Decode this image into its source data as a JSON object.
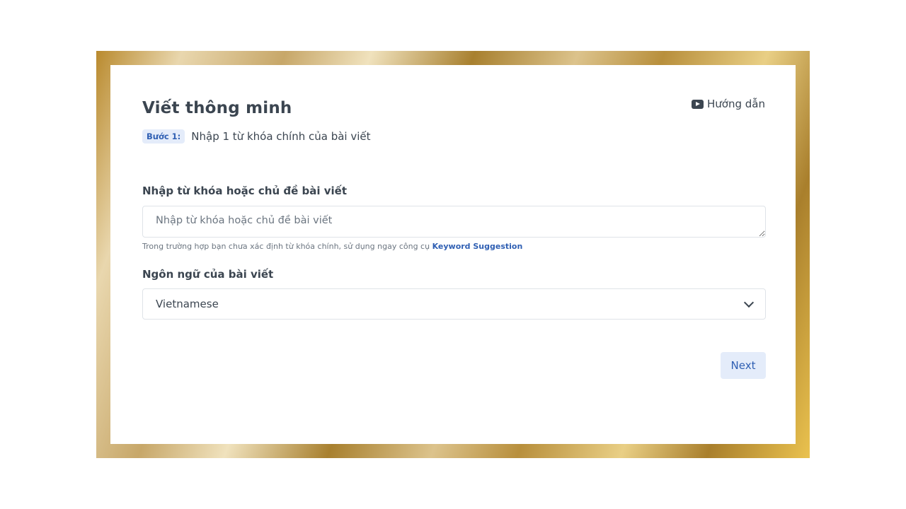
{
  "header": {
    "title": "Viết thông minh",
    "guide_label": "Hướng dẫn",
    "guide_icon": "youtube-play-icon"
  },
  "step": {
    "badge": "Bước 1:",
    "text": "Nhập 1 từ khóa chính của bài viết"
  },
  "keyword_field": {
    "label": "Nhập từ khóa hoặc chủ đề bài viết",
    "placeholder": "Nhập từ khóa hoặc chủ đề bài viết",
    "value": "",
    "hint_prefix": "Trong trường hợp bạn chưa xác định từ khóa chính, sử dụng ngay công cụ ",
    "hint_link": "Keyword Suggestion"
  },
  "language_field": {
    "label": "Ngôn ngữ của bài viết",
    "selected": "Vietnamese",
    "icon": "chevron-down-icon"
  },
  "actions": {
    "next_label": "Next"
  },
  "colors": {
    "accent": "#2f5fb3",
    "accent_bg": "#e4ecfa",
    "text": "#3b4550",
    "frame_gold": "#b98a2e"
  }
}
